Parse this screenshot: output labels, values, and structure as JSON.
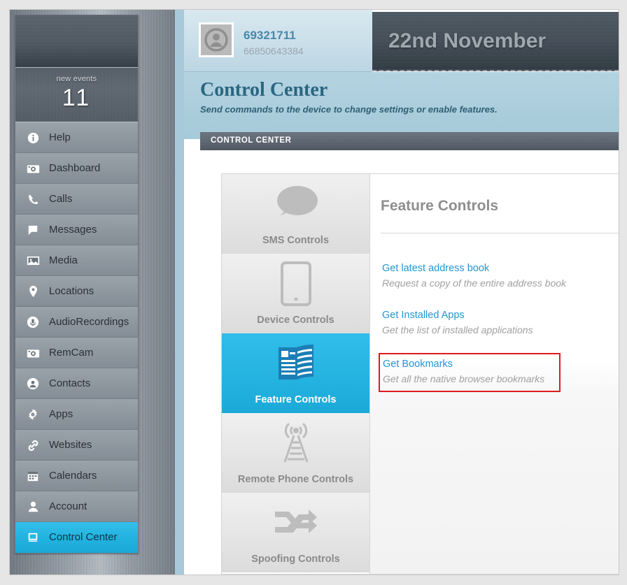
{
  "sidebar": {
    "events": {
      "label": "new events",
      "count": "11"
    },
    "items": [
      {
        "label": "Help",
        "icon": "info-icon",
        "active": false
      },
      {
        "label": "Dashboard",
        "icon": "dashboard-camera-icon",
        "active": false
      },
      {
        "label": "Calls",
        "icon": "phone-icon",
        "active": false
      },
      {
        "label": "Messages",
        "icon": "message-bubble-icon",
        "active": false
      },
      {
        "label": "Media",
        "icon": "image-icon",
        "active": false
      },
      {
        "label": "Locations",
        "icon": "map-pin-icon",
        "active": false
      },
      {
        "label": "AudioRecordings",
        "icon": "microphone-circle-icon",
        "active": false
      },
      {
        "label": "RemCam",
        "icon": "camera-icon",
        "active": false
      },
      {
        "label": "Contacts",
        "icon": "contact-circle-icon",
        "active": false
      },
      {
        "label": "Apps",
        "icon": "gear-icon",
        "active": false
      },
      {
        "label": "Websites",
        "icon": "link-icon",
        "active": false
      },
      {
        "label": "Calendars",
        "icon": "calendar-icon",
        "active": false
      },
      {
        "label": "Account",
        "icon": "person-icon",
        "active": false
      },
      {
        "label": "Control Center",
        "icon": "monitor-icon",
        "active": true
      }
    ]
  },
  "header": {
    "account_id": "69321711",
    "account_sub": "66850643384",
    "date": "22nd November",
    "avatar_icon": "user-avatar-icon"
  },
  "page": {
    "title": "Control Center",
    "subtitle": "Send commands to the device to change settings or enable features.",
    "section_label": "CONTROL CENTER"
  },
  "tiles": [
    {
      "label": "SMS Controls",
      "icon": "speech-bubble-icon",
      "active": false
    },
    {
      "label": "Device Controls",
      "icon": "tablet-icon",
      "active": false
    },
    {
      "label": "Feature Controls",
      "icon": "book-icon",
      "active": true
    },
    {
      "label": "Remote Phone Controls",
      "icon": "antenna-tower-icon",
      "active": false
    },
    {
      "label": "Spoofing Controls",
      "icon": "shuffle-arrows-icon",
      "active": false
    }
  ],
  "detail": {
    "title": "Feature Controls",
    "commands": [
      {
        "link": "Get latest address book",
        "desc": "Request a copy of the entire address book",
        "highlighted": false
      },
      {
        "link": "Get Installed Apps",
        "desc": "Get the list of installed applications",
        "highlighted": false
      },
      {
        "link": "Get Bookmarks",
        "desc": "Get all the native browser bookmarks",
        "highlighted": true
      }
    ]
  },
  "colors": {
    "accent_cyan": "#24b2e0",
    "link_blue": "#2196d4",
    "title_blue": "#2b6680",
    "highlight_red": "#e01b1b",
    "heading_band": "#aacddc"
  }
}
